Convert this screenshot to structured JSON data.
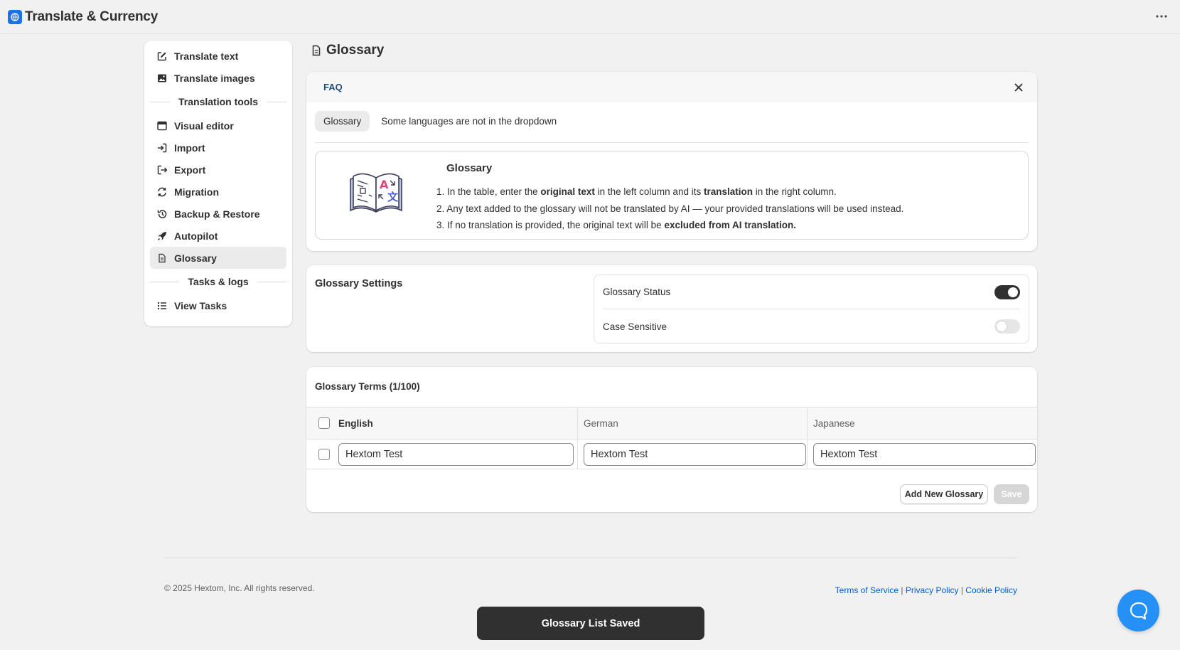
{
  "app": {
    "title": "Translate & Currency"
  },
  "sidebar": {
    "items": [
      {
        "label": "Translate text",
        "icon": "edit-icon"
      },
      {
        "label": "Translate images",
        "icon": "image-icon"
      }
    ],
    "section_tools": "Translation tools",
    "tools": [
      {
        "label": "Visual editor",
        "icon": "window-icon"
      },
      {
        "label": "Import",
        "icon": "import-icon"
      },
      {
        "label": "Export",
        "icon": "export-icon"
      },
      {
        "label": "Migration",
        "icon": "refresh-icon"
      },
      {
        "label": "Backup & Restore",
        "icon": "history-icon"
      },
      {
        "label": "Autopilot",
        "icon": "rocket-icon"
      },
      {
        "label": "Glossary",
        "icon": "document-icon",
        "active": true
      }
    ],
    "section_tasks": "Tasks & logs",
    "tasks": [
      {
        "label": "View Tasks",
        "icon": "list-icon"
      }
    ]
  },
  "page": {
    "title": "Glossary"
  },
  "faq": {
    "header": "FAQ",
    "tabs": [
      "Glossary",
      "Some languages are not in the dropdown"
    ],
    "box_title": "Glossary",
    "line1": {
      "n": "1. ",
      "a": "In the table, enter the ",
      "b": "original text",
      "c": " in the left column and its ",
      "d": "translation",
      "e": " in the right column."
    },
    "line2": {
      "n": "2. ",
      "a": "Any text added to the glossary will not be translated by AI — your provided translations will be used instead."
    },
    "line3": {
      "n": "3. ",
      "a": "If no translation is provided, the original text will be ",
      "b": "excluded from AI translation."
    }
  },
  "settings": {
    "title": "Glossary Settings",
    "status_label": "Glossary Status",
    "status_on": true,
    "case_label": "Case Sensitive",
    "case_on": false
  },
  "terms": {
    "title": "Glossary Terms (1/100)",
    "columns": [
      "English",
      "German",
      "Japanese"
    ],
    "rows": [
      {
        "english": "Hextom Test",
        "german": "Hextom Test",
        "japanese": "Hextom Test"
      }
    ],
    "add_label": "Add New Glossary",
    "save_label": "Save"
  },
  "footer": {
    "copyright": "© 2025 Hextom, Inc. All rights reserved.",
    "links": [
      "Terms of Service",
      "Privacy Policy",
      "Cookie Policy"
    ],
    "separator": " | "
  },
  "toast": "Glossary List Saved",
  "colors": {
    "accent": "#1a73e8",
    "link": "#005bd3",
    "chat": "#2590f5",
    "toast": "#303030"
  }
}
